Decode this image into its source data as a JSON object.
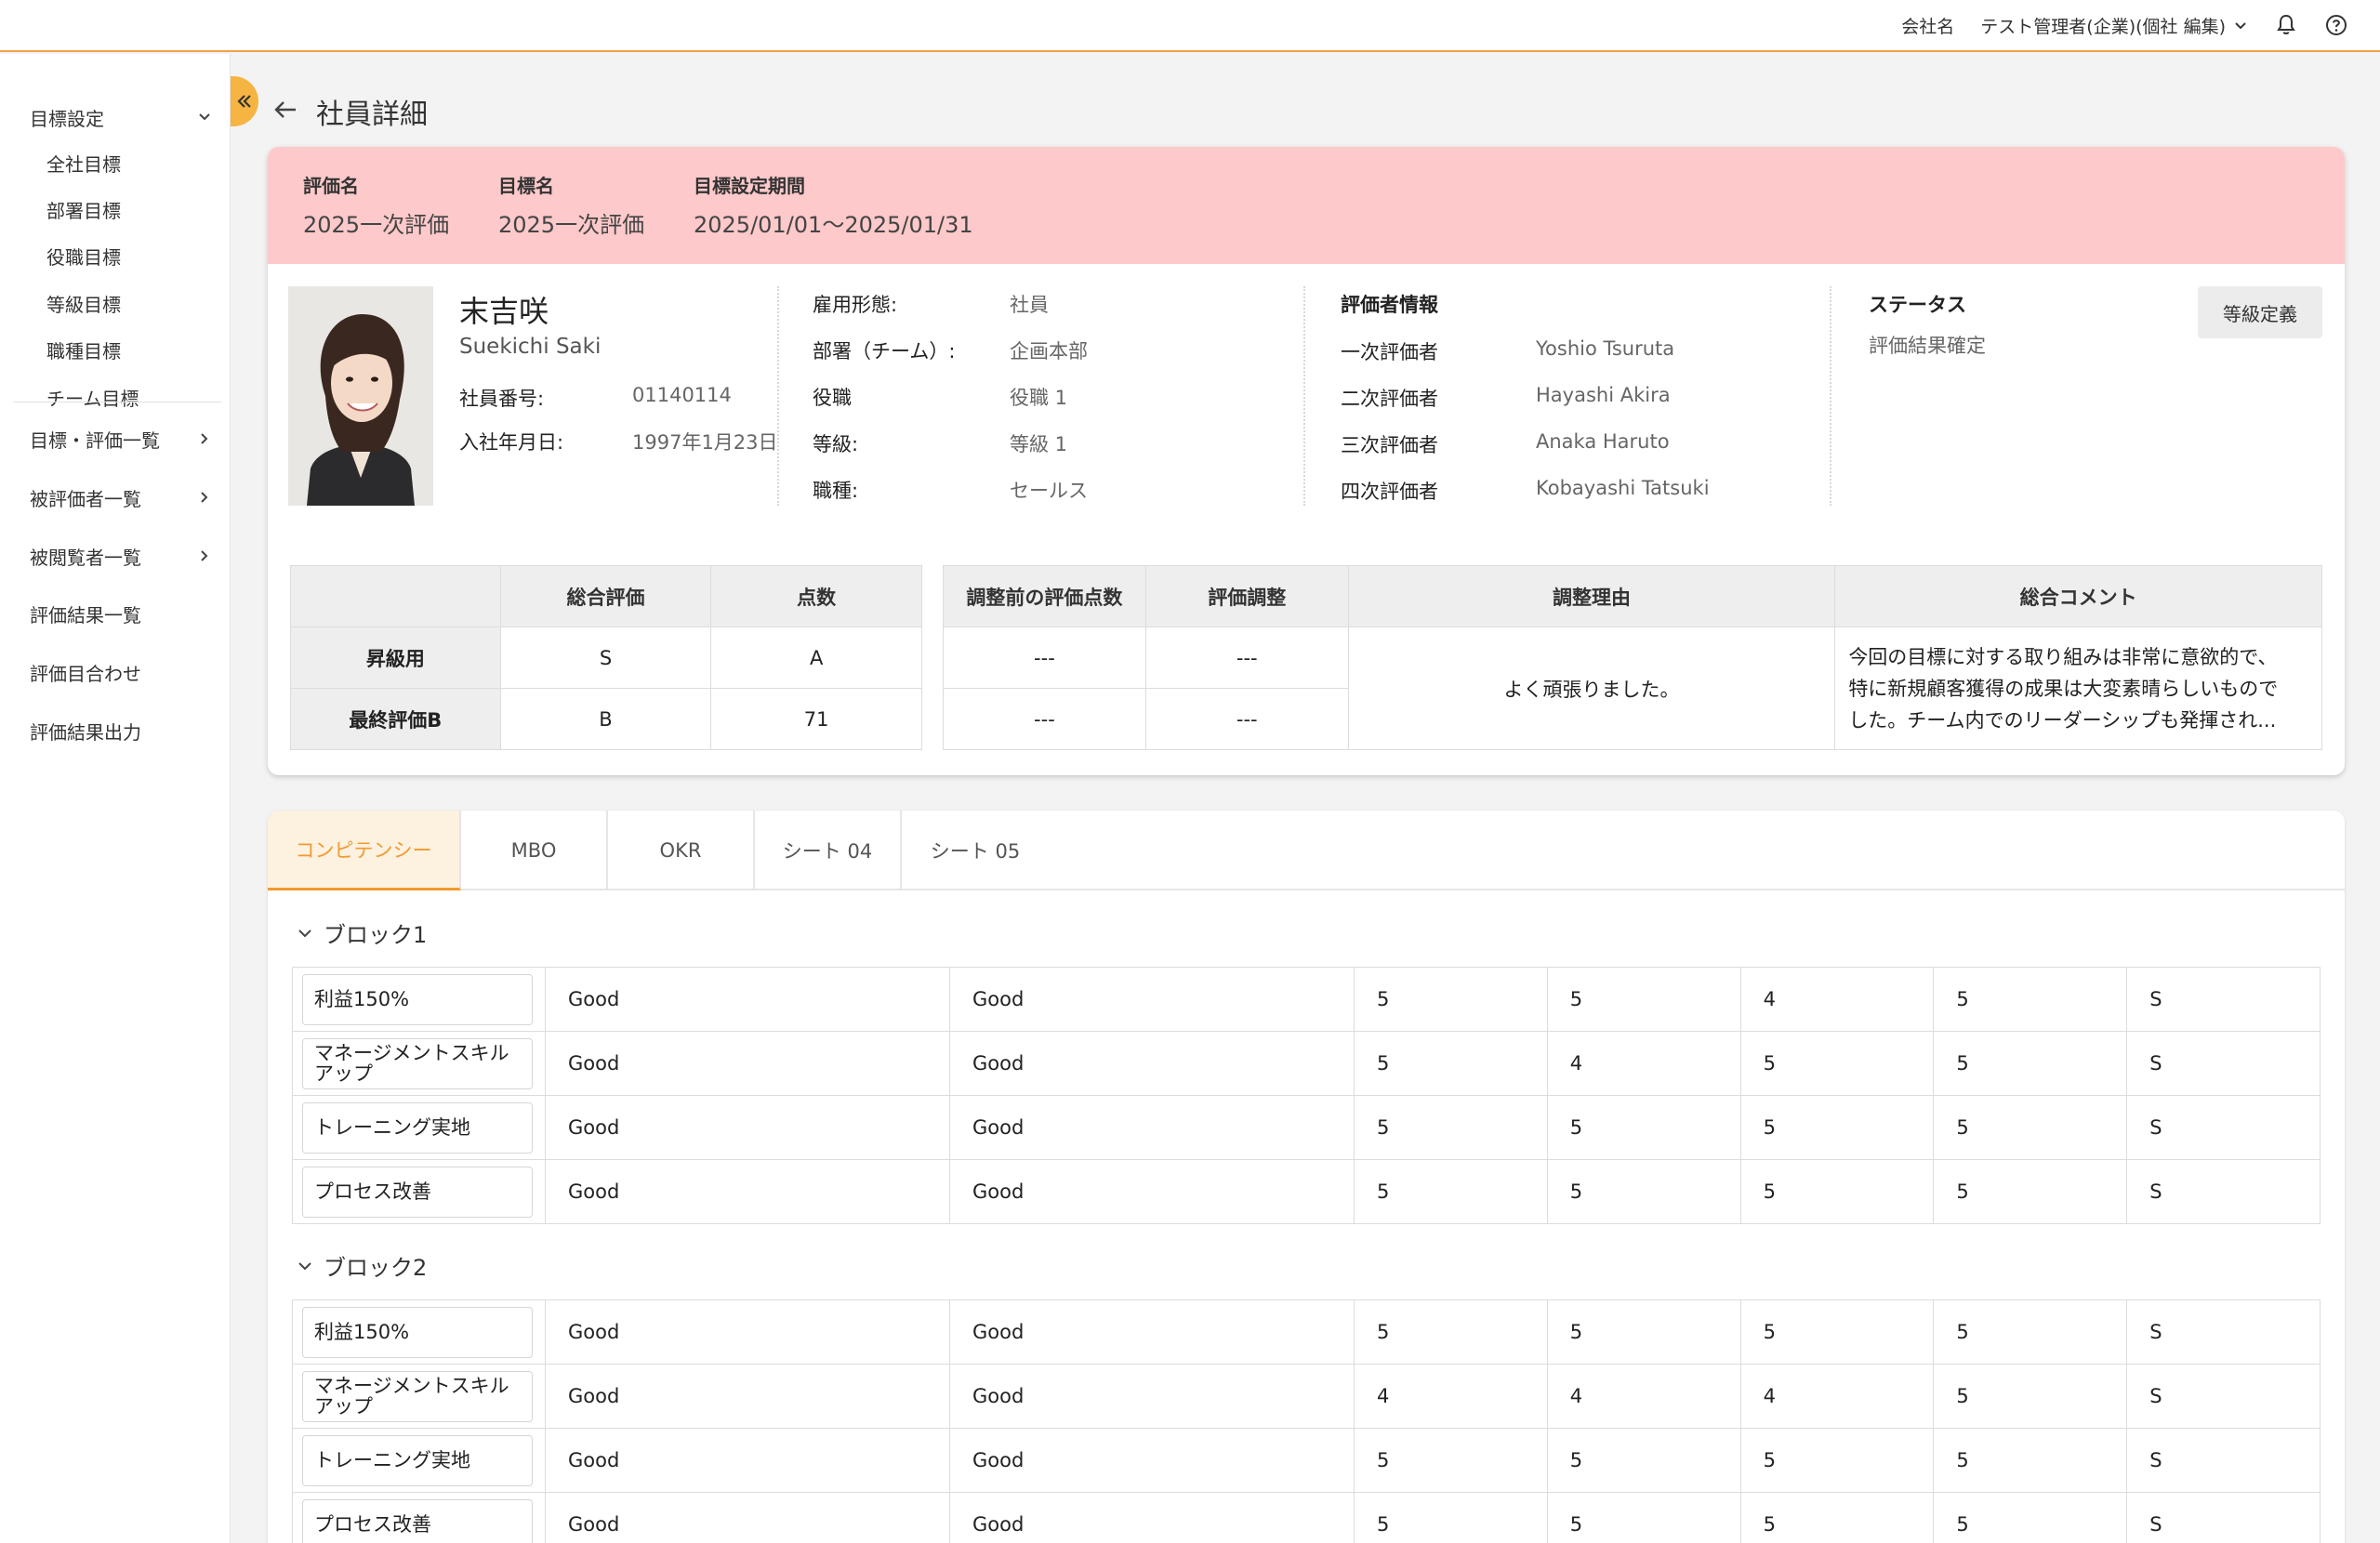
{
  "header": {
    "company_label": "会社名",
    "user_label": "テスト管理者(企業)(個社 編集)"
  },
  "sidebar": {
    "goal_setting": "目標設定",
    "sub_items": [
      "全社目標",
      "部署目標",
      "役職目標",
      "等級目標",
      "職種目標",
      "チーム目標"
    ],
    "goal_eval_list": "目標・評価一覧",
    "evaluatee_list": "被評価者一覧",
    "viewer_list": "被閲覧者一覧",
    "result_list": "評価結果一覧",
    "eval_meeting": "評価目合わせ",
    "result_export": "評価結果出力"
  },
  "page": {
    "title": "社員詳細"
  },
  "banner": {
    "eval_name_label": "評価名",
    "eval_name": "2025一次評価",
    "goal_name_label": "目標名",
    "goal_name": "2025一次評価",
    "period_label": "目標設定期間",
    "period": "2025/01/01〜2025/01/31"
  },
  "employee": {
    "name": "末吉咲",
    "name_roman": "Suekichi Saki",
    "emp_no_label": "社員番号:",
    "emp_no": "01140114",
    "join_label": "入社年月日:",
    "join_date": "1997年1月23日",
    "employment_label": "雇用形態:",
    "employment": "社員",
    "dept_label": "部署（チーム）:",
    "dept": "企画本部",
    "position_label": "役職",
    "position": "役職 1",
    "grade_label": "等級:",
    "grade": "等級 1",
    "job_label": "職種:",
    "job": "セールス"
  },
  "evaluators": {
    "title": "評価者情報",
    "rows": [
      {
        "label": "一次評価者",
        "name": "Yoshio Tsuruta"
      },
      {
        "label": "二次評価者",
        "name": "Hayashi Akira"
      },
      {
        "label": "三次評価者",
        "name": "Anaka Haruto"
      },
      {
        "label": "四次評価者",
        "name": "Kobayashi Tatsuki"
      }
    ]
  },
  "status": {
    "title": "ステータス",
    "value": "評価結果確定",
    "grade_button": "等級定義"
  },
  "summary": {
    "headers": {
      "overall": "総合評価",
      "score": "点数"
    },
    "rows": [
      {
        "label": "昇級用",
        "overall": "S",
        "score": "A"
      },
      {
        "label": "最終評価B",
        "overall": "B",
        "score": "71"
      }
    ],
    "adj_headers": {
      "before": "調整前の評価点数",
      "adjust": "評価調整",
      "reason": "調整理由",
      "comment": "総合コメント"
    },
    "adj_rows": [
      {
        "before": "---",
        "adjust": "---"
      },
      {
        "before": "---",
        "adjust": "---"
      }
    ],
    "reason": "よく頑張りました。",
    "comment_lines": [
      "今回の目標に対する取り組みは非常に意欲的で、",
      "特に新規顧客獲得の成果は大変素晴らしいもので",
      "した。チーム内でのリーダーシップも発揮され..."
    ]
  },
  "tabs": [
    "コンピテンシー",
    "MBO",
    "OKR",
    "シート 04",
    "シート 05"
  ],
  "blocks": [
    {
      "title": "ブロック1",
      "rows": [
        {
          "name": [
            "利益150%"
          ],
          "cells": [
            "Good",
            "Good",
            "5",
            "5",
            "4",
            "5",
            "S"
          ]
        },
        {
          "name": [
            "マネージメントスキル",
            "アップ"
          ],
          "cells": [
            "Good",
            "Good",
            "5",
            "4",
            "5",
            "5",
            "S"
          ]
        },
        {
          "name": [
            "トレーニング実地"
          ],
          "cells": [
            "Good",
            "Good",
            "5",
            "5",
            "5",
            "5",
            "S"
          ]
        },
        {
          "name": [
            "プロセス改善"
          ],
          "cells": [
            "Good",
            "Good",
            "5",
            "5",
            "5",
            "5",
            "S"
          ]
        }
      ]
    },
    {
      "title": "ブロック2",
      "rows": [
        {
          "name": [
            "利益150%"
          ],
          "cells": [
            "Good",
            "Good",
            "5",
            "5",
            "5",
            "5",
            "S"
          ]
        },
        {
          "name": [
            "マネージメントスキル",
            "アップ"
          ],
          "cells": [
            "Good",
            "Good",
            "4",
            "4",
            "4",
            "5",
            "S"
          ]
        },
        {
          "name": [
            "トレーニング実地"
          ],
          "cells": [
            "Good",
            "Good",
            "5",
            "5",
            "5",
            "5",
            "S"
          ]
        },
        {
          "name": [
            "プロセス改善"
          ],
          "cells": [
            "Good",
            "Good",
            "5",
            "5",
            "5",
            "5",
            "S"
          ]
        }
      ]
    }
  ],
  "colors": {
    "accent": "#f19a2f",
    "banner": "#fdc9ca",
    "collapse": "#f6b443"
  }
}
